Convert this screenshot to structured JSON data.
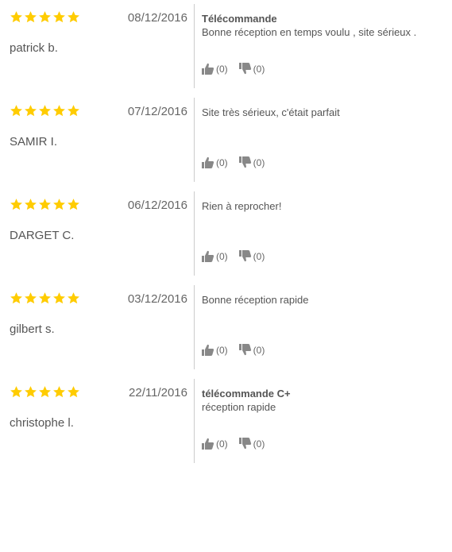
{
  "colors": {
    "star": "#FFCC00",
    "divider": "#cccccc",
    "text": "#555555",
    "thumb": "#888888"
  },
  "icons": {
    "rating": "star-icon",
    "upvote": "thumbs-up-icon",
    "downvote": "thumbs-down-icon"
  },
  "reviews": [
    {
      "rating": 5,
      "date": "08/12/2016",
      "author": "patrick b.",
      "title": "Télécommande",
      "text": "Bonne réception en temps voulu , site sérieux .",
      "up": "(0)",
      "down": "(0)"
    },
    {
      "rating": 5,
      "date": "07/12/2016",
      "author": "SAMIR I.",
      "title": "",
      "text": "Site très sérieux, c'était parfait",
      "up": "(0)",
      "down": "(0)"
    },
    {
      "rating": 5,
      "date": "06/12/2016",
      "author": "DARGET C.",
      "title": "",
      "text": "Rien à reprocher!",
      "up": "(0)",
      "down": "(0)"
    },
    {
      "rating": 5,
      "date": "03/12/2016",
      "author": "gilbert s.",
      "title": "",
      "text": "Bonne réception rapide",
      "up": "(0)",
      "down": "(0)"
    },
    {
      "rating": 5,
      "date": "22/11/2016",
      "author": "christophe l.",
      "title": "télécommande C+",
      "text": "réception rapide",
      "up": "(0)",
      "down": "(0)"
    }
  ]
}
